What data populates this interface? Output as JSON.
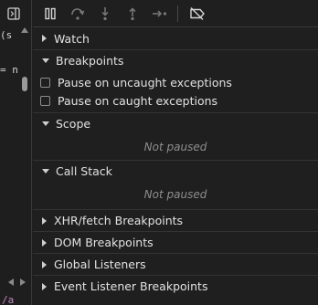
{
  "code": {
    "line1": "(s",
    "line2": "= n",
    "line3": "/a"
  },
  "toolbar": {
    "pause_icon": "pause-icon",
    "step_over_icon": "step-over-icon",
    "step_into_icon": "step-into-icon",
    "step_out_icon": "step-out-icon",
    "step_icon": "step-icon",
    "deactivate_icon": "deactivate-breakpoints-icon"
  },
  "sections": {
    "watch": "Watch",
    "breakpoints": "Breakpoints",
    "pause_uncaught": "Pause on uncaught exceptions",
    "pause_caught": "Pause on caught exceptions",
    "scope": "Scope",
    "scope_status": "Not paused",
    "call_stack": "Call Stack",
    "call_stack_status": "Not paused",
    "xhr": "XHR/fetch Breakpoints",
    "dom": "DOM Breakpoints",
    "global_listeners": "Global Listeners",
    "event_listener": "Event Listener Breakpoints"
  },
  "colors": {
    "background": "#1f1f1f",
    "accent_blue": "#4a9df7"
  }
}
